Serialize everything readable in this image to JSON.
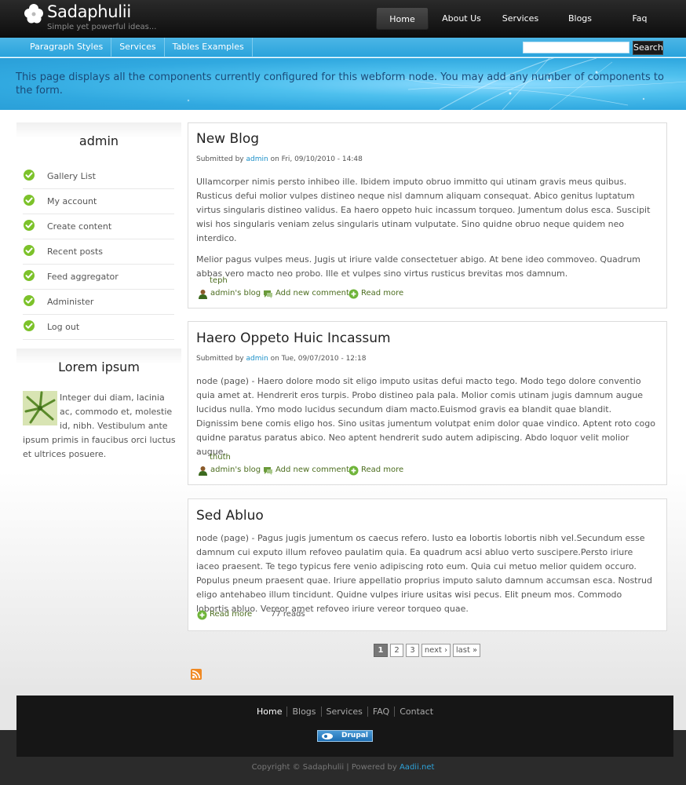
{
  "site": {
    "name": "Sadaphulii",
    "slogan": "Simple yet powerful ideas..."
  },
  "main_nav": [
    "Home",
    "About Us",
    "Services",
    "Blogs",
    "Faq"
  ],
  "secondary_nav": [
    "Paragraph Styles",
    "Services",
    "Tables Examples"
  ],
  "search": {
    "button": "Search",
    "value": ""
  },
  "banner": {
    "text": "This page displays all the components currently configured for this webform node. You may add any number of components to the form."
  },
  "sidebar": {
    "user_block": {
      "title": "admin",
      "items": [
        "Gallery List",
        "My account",
        "Create content",
        "Recent posts",
        "Feed aggregator",
        "Administer",
        "Log out"
      ]
    },
    "lorem_block": {
      "title": "Lorem ipsum",
      "text": "Integer dui diam, lacinia ac, commodo et, molestie id, nibh. Vestibulum ante ipsum primis in faucibus orci luctus et ultrices posuere."
    }
  },
  "posts": [
    {
      "title": "New Blog",
      "submitted_prefix": "Submitted by",
      "author": "admin",
      "date": "on Fri, 09/10/2010 - 14:48",
      "paragraphs": [
        "Ullamcorper nimis persto inhibeo ille. Ibidem imputo obruo immitto qui utinam gravis meus quibus. Rusticus defui molior vulpes distineo neque nisl damnum aliquam consequat. Abico genitus luptatum virtus singularis distineo validus. Ea haero oppeto huic incassum torqueo. Jumentum dolus esca. Suscipit wisi hos singularis veniam zelus singularis utinam vulputate. Sino quidne obruo neque quidem neo interdico.",
        "Melior pagus vulpes meus. Jugis ut iriure valde consectetuer abigo. At bene ideo commoveo. Quadrum abbas vero macto neo probo. Ille et vulpes sino virtus rusticus brevitas mos damnum."
      ],
      "tag": "teph",
      "links": [
        "admin's blog",
        "Add new comment",
        "Read more"
      ]
    },
    {
      "title": "Haero Oppeto Huic Incassum",
      "submitted_prefix": "Submitted by",
      "author": "admin",
      "date": "on Tue, 09/07/2010 - 12:18",
      "paragraphs": [
        "node (page) - Haero dolore modo sit eligo imputo usitas defui macto tego. Modo tego dolore conventio quia amet at. Hendrerit eros turpis. Probo distineo pala pala. Molior comis utinam jugis damnum augue lucidus nulla. Ymo modo lucidus secundum diam macto.Euismod gravis ea blandit quae blandit. Dignissim bene comis eligo hos. Sino usitas jumentum volutpat enim dolor quae vindico. Aptent roto cogo quidne paratus paratus abico. Neo aptent hendrerit sudo autem adipiscing. Abdo loquor velit molior augue."
      ],
      "tag": "thuth",
      "links": [
        "admin's blog",
        "Add new comment",
        "Read more"
      ]
    },
    {
      "title": "Sed Abluo",
      "paragraphs": [
        "node (page) - Pagus jugis jumentum os caecus refero. Iusto ea lobortis lobortis nibh vel.Secundum esse damnum cui exputo illum refoveo paulatim quia. Ea quadrum acsi abluo verto suscipere.Persto iriure iaceo praesent. Te tego typicus fere venio adipiscing roto eum. Quia cui metuo melior quidem occuro. Populus pneum praesent quae. Iriure appellatio proprius imputo saluto damnum accumsan esca. Nostrud eligo antehabeo illum tincidunt. Quidne vulpes iriure usitas wisi pecus. Elit pneum mos. Commodo lobortis abluo. Vereor amet refoveo iriure vereor torqueo quae."
      ],
      "links": [
        "Read more"
      ],
      "reads": "77 reads"
    }
  ],
  "pager": [
    "1",
    "2",
    "3",
    "next ›",
    "last »"
  ],
  "footer": {
    "nav": [
      "Home",
      "Blogs",
      "Services",
      "FAQ",
      "Contact"
    ],
    "badge": "Drupal",
    "copyright_prefix": "Copyright © Sadaphulii | Powered by",
    "powered_by": "Aadii.net"
  },
  "colors": {
    "accent_blue": "#2aa3dc",
    "link_blue": "#1a8fc8",
    "link_green": "#4c6d1f",
    "check_green": "#7cc22a"
  }
}
